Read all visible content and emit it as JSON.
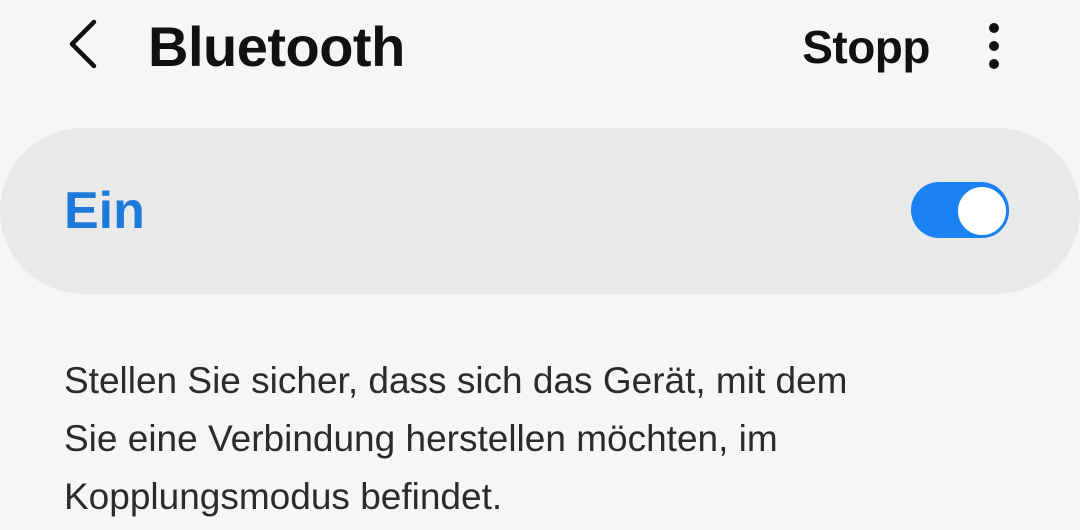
{
  "colors": {
    "background": "#f6f6f6",
    "card_background": "#e9e9e9",
    "accent": "#1e7ad8",
    "switch_on": "#1a82f3",
    "text_primary": "#111111",
    "text_secondary": "#2b2b2b"
  },
  "header": {
    "back_icon": "chevron-left-icon",
    "title": "Bluetooth",
    "stop_label": "Stopp",
    "more_icon": "more-vertical-icon"
  },
  "toggle": {
    "label": "Ein",
    "state_on": true
  },
  "hint": {
    "line1": "Stellen Sie sicher, dass sich das Gerät, mit dem",
    "line2": "Sie eine Verbindung herstellen möchten, im",
    "line3": "Kopplungsmodus befindet."
  }
}
